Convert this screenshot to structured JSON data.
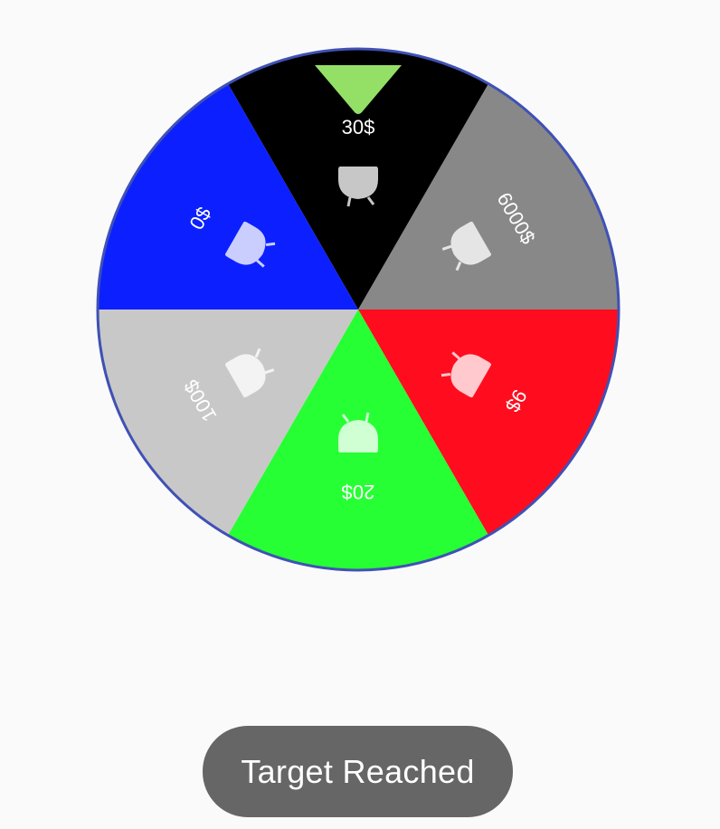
{
  "wheel": {
    "segments": [
      {
        "label": "30$",
        "color": "#000000"
      },
      {
        "label": "6000$",
        "color": "#888888"
      },
      {
        "label": "9$",
        "color": "#ff0d1f"
      },
      {
        "label": "20$",
        "color": "#26ff33"
      },
      {
        "label": "100$",
        "color": "#c8c8c8"
      },
      {
        "label": "0$",
        "color": "#0c20ff"
      }
    ],
    "border_color": "#3f51b5",
    "pointer_color": "#94e067",
    "icon": "cauldron-icon"
  },
  "toast": {
    "message": "Target Reached"
  }
}
